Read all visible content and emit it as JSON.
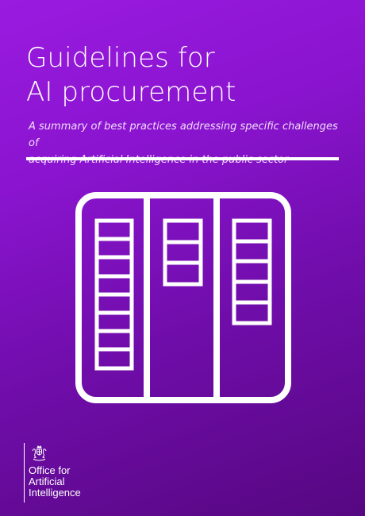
{
  "cover": {
    "title_lines": [
      "Guidelines for",
      "AI procurement"
    ],
    "subtitle_lines": [
      "A summary of best practices addressing specific challenges of",
      "acquiring Artificial Intelligence in the public sector"
    ],
    "illustration_icon": "filing-panels-icon",
    "background_colors": [
      "#9a1be0",
      "#560781"
    ],
    "foreground_color": "#ffffff"
  },
  "logo": {
    "crest_icon": "royal-coat-of-arms-icon",
    "org_lines": [
      "Office for",
      "Artificial",
      "Intelligence"
    ]
  }
}
